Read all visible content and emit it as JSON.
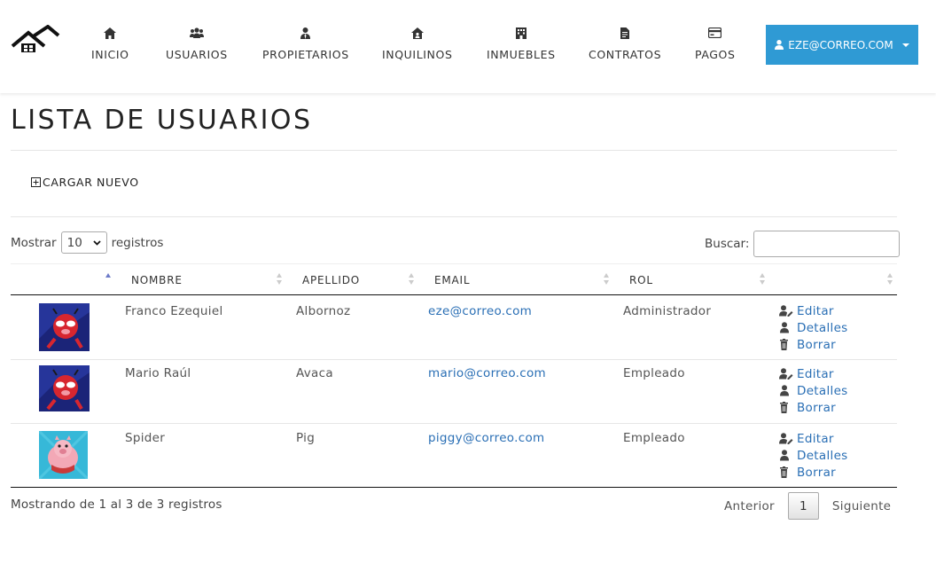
{
  "nav": {
    "items": [
      {
        "label": "INICIO",
        "icon": "home-icon"
      },
      {
        "label": "USUARIOS",
        "icon": "users-icon"
      },
      {
        "label": "PROPIETARIOS",
        "icon": "user-tie-icon"
      },
      {
        "label": "INQUILINOS",
        "icon": "house-user-icon"
      },
      {
        "label": "INMUEBLES",
        "icon": "building-icon"
      },
      {
        "label": "CONTRATOS",
        "icon": "file-contract-icon"
      },
      {
        "label": "PAGOS",
        "icon": "credit-card-icon"
      }
    ],
    "user_label": "EZE@CORREO.COM",
    "accent": "#2f9ad4"
  },
  "page": {
    "title": "LISTA DE USUARIOS",
    "add_label": "CARGAR NUEVO"
  },
  "table_controls": {
    "show_prefix": "Mostrar",
    "page_length": "10",
    "show_suffix": "registros",
    "search_label": "Buscar:",
    "search_value": ""
  },
  "table": {
    "columns": [
      "",
      "NOMBRE",
      "APELLIDO",
      "EMAIL",
      "ROL",
      ""
    ],
    "rows": [
      {
        "nombre": "Franco Ezequiel",
        "apellido": "Albornoz",
        "email": "eze@correo.com",
        "rol": "Administrador",
        "avatar": "spider-ham-avatar"
      },
      {
        "nombre": "Mario Raúl",
        "apellido": "Avaca",
        "email": "mario@correo.com",
        "rol": "Empleado",
        "avatar": "spider-ham-avatar"
      },
      {
        "nombre": "Spider",
        "apellido": "Pig",
        "email": "piggy@correo.com",
        "rol": "Empleado",
        "avatar": "pig-avatar"
      }
    ],
    "actions": {
      "edit": "Editar",
      "details": "Detalles",
      "delete": "Borrar"
    },
    "link_color": "#2a6fb5"
  },
  "footer": {
    "info": "Mostrando de 1 al 3 de 3 registros",
    "prev": "Anterior",
    "current_page": "1",
    "next": "Siguiente"
  }
}
